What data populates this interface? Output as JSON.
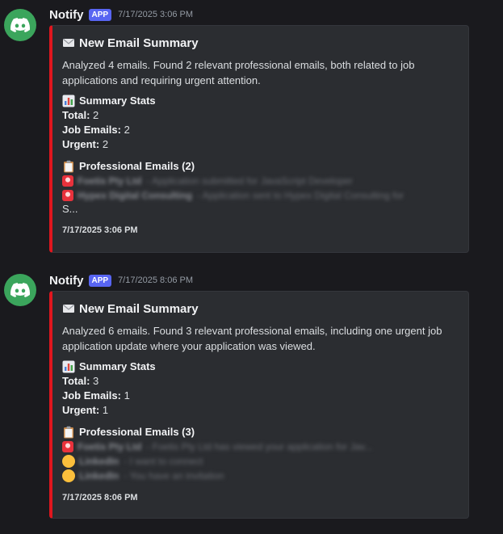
{
  "messages": [
    {
      "username": "Notify",
      "badge": "APP",
      "timestamp": "7/17/2025 3:06 PM",
      "embed": {
        "accent_color": "#e0161e",
        "title": "New Email Summary",
        "description": "Analyzed 4 emails. Found 2 relevant professional emails, both related to job applications and requiring urgent attention.",
        "stats_title": "Summary Stats",
        "stats": [
          {
            "label": "Total:",
            "value": "2"
          },
          {
            "label": "Job Emails:",
            "value": "2"
          },
          {
            "label": "Urgent:",
            "value": "2"
          }
        ],
        "emails_title": "Professional Emails (2)",
        "emails": [
          {
            "icon": "siren-icon",
            "sender": "Foetis Pty Ltd",
            "summary": "- Application submitted for JavaScript Developer"
          },
          {
            "icon": "siren-icon",
            "sender": "Hypex Digital Consulting",
            "summary": "- Application sent to Hypex Digital Consulting for"
          }
        ],
        "overflow_text": "S...",
        "footer": "7/17/2025 3:06 PM"
      }
    },
    {
      "username": "Notify",
      "badge": "APP",
      "timestamp": "7/17/2025 8:06 PM",
      "embed": {
        "accent_color": "#e0161e",
        "title": "New Email Summary",
        "description": "Analyzed 6 emails. Found 3 relevant professional emails, including one urgent job application update where your application was viewed.",
        "stats_title": "Summary Stats",
        "stats": [
          {
            "label": "Total:",
            "value": "3"
          },
          {
            "label": "Job Emails:",
            "value": "1"
          },
          {
            "label": "Urgent:",
            "value": "1"
          }
        ],
        "emails_title": "Professional Emails (3)",
        "emails": [
          {
            "icon": "siren-icon",
            "sender": "Foetis Pty Ltd",
            "summary": "- Foetis Pty Ltd has viewed your application for Jav..."
          },
          {
            "icon": "yellow-circle-icon",
            "sender": "LinkedIn",
            "summary": "- I want to connect"
          },
          {
            "icon": "yellow-circle-icon",
            "sender": "LinkedIn",
            "summary": "- You have an invitation"
          }
        ],
        "footer": "7/17/2025 8:06 PM"
      }
    }
  ],
  "colors": {
    "background": "#1a1a1e",
    "embed_background": "#2b2d31",
    "avatar": "#3ba55c",
    "badge": "#5865f2",
    "accent": "#e0161e"
  }
}
